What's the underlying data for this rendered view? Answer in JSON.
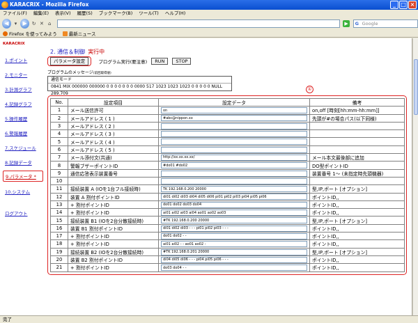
{
  "window": {
    "title": "KARACRIX - Mozilla Firefox"
  },
  "menu": [
    "ファイル(F)",
    "編集(E)",
    "表示(V)",
    "履歴(S)",
    "ブックマーク(B)",
    "ツール(T)",
    "ヘルプ(H)"
  ],
  "nav": {
    "url": "",
    "search_placeholder": "Google"
  },
  "bookmarks": [
    "Firefox を使ってみよう",
    "最新ニュース"
  ],
  "status": "完了",
  "brand": "KARACRIX",
  "sidebar": {
    "items": [
      "1.ポイント",
      "2.モニター",
      "3.計測グラフ",
      "4.記録グラフ",
      "5.操作履歴",
      "6.警報履歴",
      "7.スケジュール",
      "8.記録データ",
      "9.パラメータ *",
      "10.システム"
    ],
    "logout": "ログアウト"
  },
  "header": {
    "section": "2. 通信＆制御",
    "running": "実行中",
    "param_button": "パラメータ設定",
    "run_label": "プログラム実行(要注意)",
    "run_button": "RUN",
    "stop_button": "STOP"
  },
  "messages": {
    "title": "プログラムのメッセージ",
    "title_note": "(前回取得値)",
    "mode": "通信モード",
    "line": "0841 MIX 000000 000000 0 0 0 0 0 0 0 0000 517 1023 1023 1023 0 0 0 0 0 NULL 289.709"
  },
  "table_marker": "①",
  "table": {
    "headers": [
      "No.",
      "設定項目",
      "設定データ",
      "備考"
    ],
    "rows": [
      {
        "no": "1",
        "item": "メール送信許可",
        "data": "on",
        "note": "on,off [時刻[hh:mm-hh:mm]]"
      },
      {
        "no": "2",
        "item": "メールアドレス ( 1 )",
        "data": "#abc@nippon.xx",
        "note": "先頭が#の場合パス(以下同様)"
      },
      {
        "no": "3",
        "item": "メールアドレス ( 2 )",
        "data": "",
        "note": ""
      },
      {
        "no": "4",
        "item": "メールアドレス ( 3 )",
        "data": "",
        "note": ""
      },
      {
        "no": "5",
        "item": "メールアドレス ( 4 )",
        "data": "",
        "note": ""
      },
      {
        "no": "6",
        "item": "メールアドレス ( 5 )",
        "data": "",
        "note": ""
      },
      {
        "no": "7",
        "item": "メール添付文(共通)",
        "data": "http://xx.xx.xx.xx/",
        "note": "メール本文最後部に追加"
      },
      {
        "no": "8",
        "item": "警報ブザーポイントID",
        "data": "#do01 #do02",
        "note": "DO型ポイントID"
      },
      {
        "no": "9",
        "item": "通信応答表示装置番号",
        "data": "",
        "note": "装置番号 1〜 (未指定時先頭機器)"
      },
      {
        "no": "10",
        "item": "",
        "data": "",
        "note": ""
      },
      {
        "no": "11",
        "item": "接続装置 A (IOを1台フル接続時)",
        "data": "TK 192.168.0.200 20000",
        "note": "型,IP,ポート [オプション]"
      },
      {
        "no": "12",
        "item": "装置 A 割付ポイントID",
        "data": "di01 di02 di03 di04 di05 di06 pi01 pi02 pi03 pi04 pi05 pi06",
        "note": "ポイントID,,"
      },
      {
        "no": "13",
        "item": "+ 割付ポイントID",
        "data": "do01 do02 do03 do04",
        "note": "ポイントID,,"
      },
      {
        "no": "14",
        "item": "+ 割付ポイントID",
        "data": "ai01 ai02 ai03 ai04 ao01 ao02 ao03",
        "note": "ポイントID,,"
      },
      {
        "no": "15",
        "item": "接続装置 B1 (IOを2台分散接続時)",
        "data": "#TK 192.168.0.200 20000",
        "note": "型,IP,ポート [オプション]"
      },
      {
        "no": "16",
        "item": "装置 B1 割付ポイントID",
        "data": "di01 di02 di03 - - - pi01 pi02 pi03 - - -",
        "note": "ポイントID,,"
      },
      {
        "no": "17",
        "item": "+ 割付ポイントID",
        "data": "do01 do02 - -",
        "note": "ポイントID,,"
      },
      {
        "no": "18",
        "item": "+ 割付ポイントID",
        "data": "ai01 ai02 - - ao01 ao02 -",
        "note": "ポイントID,,"
      },
      {
        "no": "19",
        "item": "接続装置 B2 (IOを2台分散接続時)",
        "data": "#TK 192.168.0.201 20000",
        "note": "型,IP,ポート [オプション]"
      },
      {
        "no": "20",
        "item": "装置 B2 割付ポイントID",
        "data": "di04 di05 di06 - - - pi04 pi05 pi06 - - -",
        "note": "ポイントID,,"
      },
      {
        "no": "21",
        "item": "+ 割付ポイントID",
        "data": "do03 do04 - -",
        "note": "ポイントID,,"
      }
    ]
  }
}
